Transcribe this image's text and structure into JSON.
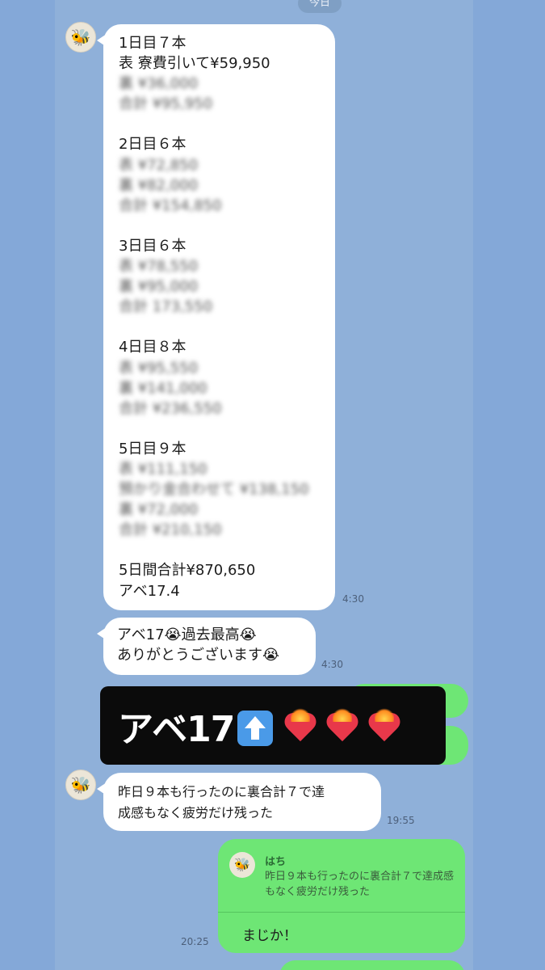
{
  "date_divider": "今日",
  "messages": {
    "m1": {
      "lines": [
        {
          "text": "1日目７本",
          "style": "plain"
        },
        {
          "text": "表 寮費引いて¥59,950",
          "style": "plain"
        },
        {
          "text": "裏 ¥36,000",
          "style": "blur"
        },
        {
          "text": "合計 ¥95,950",
          "style": "blur"
        },
        {
          "text": "",
          "style": "plain"
        },
        {
          "text": "2日目６本",
          "style": "plain"
        },
        {
          "text": "表 ¥72,850",
          "style": "blur"
        },
        {
          "text": "裏 ¥82,000",
          "style": "blur"
        },
        {
          "text": "合計 ¥154,850",
          "style": "blur"
        },
        {
          "text": "",
          "style": "plain"
        },
        {
          "text": "3日目６本",
          "style": "plain"
        },
        {
          "text": "表 ¥78,550",
          "style": "blur"
        },
        {
          "text": "裏 ¥95,000",
          "style": "blur"
        },
        {
          "text": "合計 173,550",
          "style": "blur"
        },
        {
          "text": "",
          "style": "plain"
        },
        {
          "text": "4日目８本",
          "style": "plain"
        },
        {
          "text": "表 ¥95,550",
          "style": "blur"
        },
        {
          "text": "裏 ¥141,000",
          "style": "blur"
        },
        {
          "text": "合計 ¥236,550",
          "style": "blur"
        },
        {
          "text": "",
          "style": "plain"
        },
        {
          "text": "5日目９本",
          "style": "plain"
        },
        {
          "text": "表 ¥111,150",
          "style": "blur"
        },
        {
          "text": "預かり金合わせて ¥138,150",
          "style": "blur"
        },
        {
          "text": "裏 ¥72,000",
          "style": "blur"
        },
        {
          "text": "合計 ¥210,150",
          "style": "blur"
        },
        {
          "text": "",
          "style": "plain"
        },
        {
          "text": "5日間合計¥870,650",
          "style": "plain"
        },
        {
          "text": "アベ17.4",
          "style": "plain"
        }
      ],
      "time": "4:30"
    },
    "m2": {
      "line1": "アベ17😭過去最高😭",
      "line2": "ありがとうございます😭",
      "time": "4:30"
    },
    "banner": {
      "text": "アベ17"
    },
    "m3": {
      "line1": "昨日９本も行ったのに裏合計７で達",
      "line2": "成感もなく疲労だけ残った",
      "time": "19:55"
    },
    "reply": {
      "quoted_name": "はち",
      "quoted_text": "昨日９本も行ったのに裏合計７で達成感もなく疲労だけ残った",
      "text": "まじか！",
      "time": "20:25"
    }
  }
}
